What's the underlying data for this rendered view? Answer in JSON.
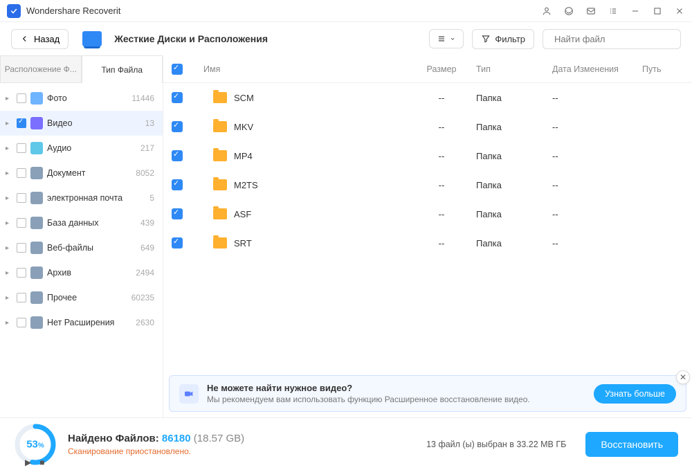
{
  "app": {
    "title": "Wondershare Recoverit"
  },
  "toolbar": {
    "back": "Назад",
    "breadcrumb": "Жесткие Диски и Расположения",
    "filter": "Фильтр",
    "search_placeholder": "Найти файл"
  },
  "sidebar": {
    "tabs": {
      "location": "Расположение Ф...",
      "filetype": "Тип Файла"
    },
    "items": [
      {
        "label": "Фото",
        "count": "11446",
        "color": "#6fb4ff",
        "checked": false,
        "selected": false
      },
      {
        "label": "Видео",
        "count": "13",
        "color": "#7a6fff",
        "checked": true,
        "selected": true
      },
      {
        "label": "Аудио",
        "count": "217",
        "color": "#5fc8e8",
        "checked": false,
        "selected": false
      },
      {
        "label": "Документ",
        "count": "8052",
        "color": "#8aa0b8",
        "checked": false,
        "selected": false
      },
      {
        "label": "электронная почта",
        "count": "5",
        "color": "#8aa0b8",
        "checked": false,
        "selected": false
      },
      {
        "label": "База данных",
        "count": "439",
        "color": "#8aa0b8",
        "checked": false,
        "selected": false
      },
      {
        "label": "Веб-файлы",
        "count": "649",
        "color": "#8aa0b8",
        "checked": false,
        "selected": false
      },
      {
        "label": "Архив",
        "count": "2494",
        "color": "#8aa0b8",
        "checked": false,
        "selected": false
      },
      {
        "label": "Прочее",
        "count": "60235",
        "color": "#8aa0b8",
        "checked": false,
        "selected": false
      },
      {
        "label": "Нет Расширения",
        "count": "2630",
        "color": "#8aa0b8",
        "checked": false,
        "selected": false
      }
    ]
  },
  "table": {
    "headers": {
      "name": "Имя",
      "size": "Размер",
      "type": "Тип",
      "date": "Дата Изменения",
      "path": "Путь"
    },
    "rows": [
      {
        "name": "SCM",
        "size": "--",
        "type": "Папка",
        "date": "--"
      },
      {
        "name": "MKV",
        "size": "--",
        "type": "Папка",
        "date": "--"
      },
      {
        "name": "MP4",
        "size": "--",
        "type": "Папка",
        "date": "--"
      },
      {
        "name": "M2TS",
        "size": "--",
        "type": "Папка",
        "date": "--"
      },
      {
        "name": "ASF",
        "size": "--",
        "type": "Папка",
        "date": "--"
      },
      {
        "name": "SRT",
        "size": "--",
        "type": "Папка",
        "date": "--"
      }
    ]
  },
  "tip": {
    "title": "Не можете найти нужное видео?",
    "subtitle": "Мы рекомендуем вам использовать функцию Расширенное восстановление видео.",
    "button": "Узнать больше"
  },
  "footer": {
    "progress_pct": "53",
    "found_label": "Найдено Файлов:",
    "found_count": "86180",
    "found_size": "(18.57 GB)",
    "scan_status": "Сканирование приостановлено.",
    "selection_info": "13 файл (ы) выбран в 33.22 МВ ГБ",
    "recover": "Восстановить"
  }
}
